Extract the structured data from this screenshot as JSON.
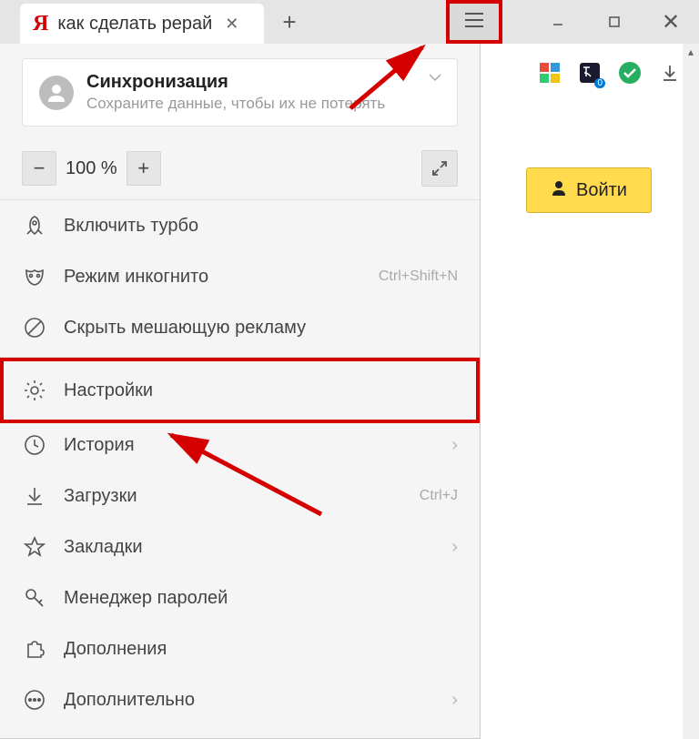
{
  "tab": {
    "title": "как сделать рерай"
  },
  "sync": {
    "title": "Синхронизация",
    "subtitle": "Сохраните данные, чтобы их не потерять"
  },
  "zoom": {
    "level": "100 %"
  },
  "menu": {
    "turbo": "Включить турбо",
    "incognito": "Режим инкогнито",
    "incognito_shortcut": "Ctrl+Shift+N",
    "hide_ads": "Скрыть мешающую рекламу",
    "settings": "Настройки",
    "history": "История",
    "downloads": "Загрузки",
    "downloads_shortcut": "Ctrl+J",
    "bookmarks": "Закладки",
    "passwords": "Менеджер паролей",
    "addons": "Дополнения",
    "more": "Дополнительно"
  },
  "login": {
    "label": "Войти"
  },
  "ext": {
    "badge": "0"
  }
}
